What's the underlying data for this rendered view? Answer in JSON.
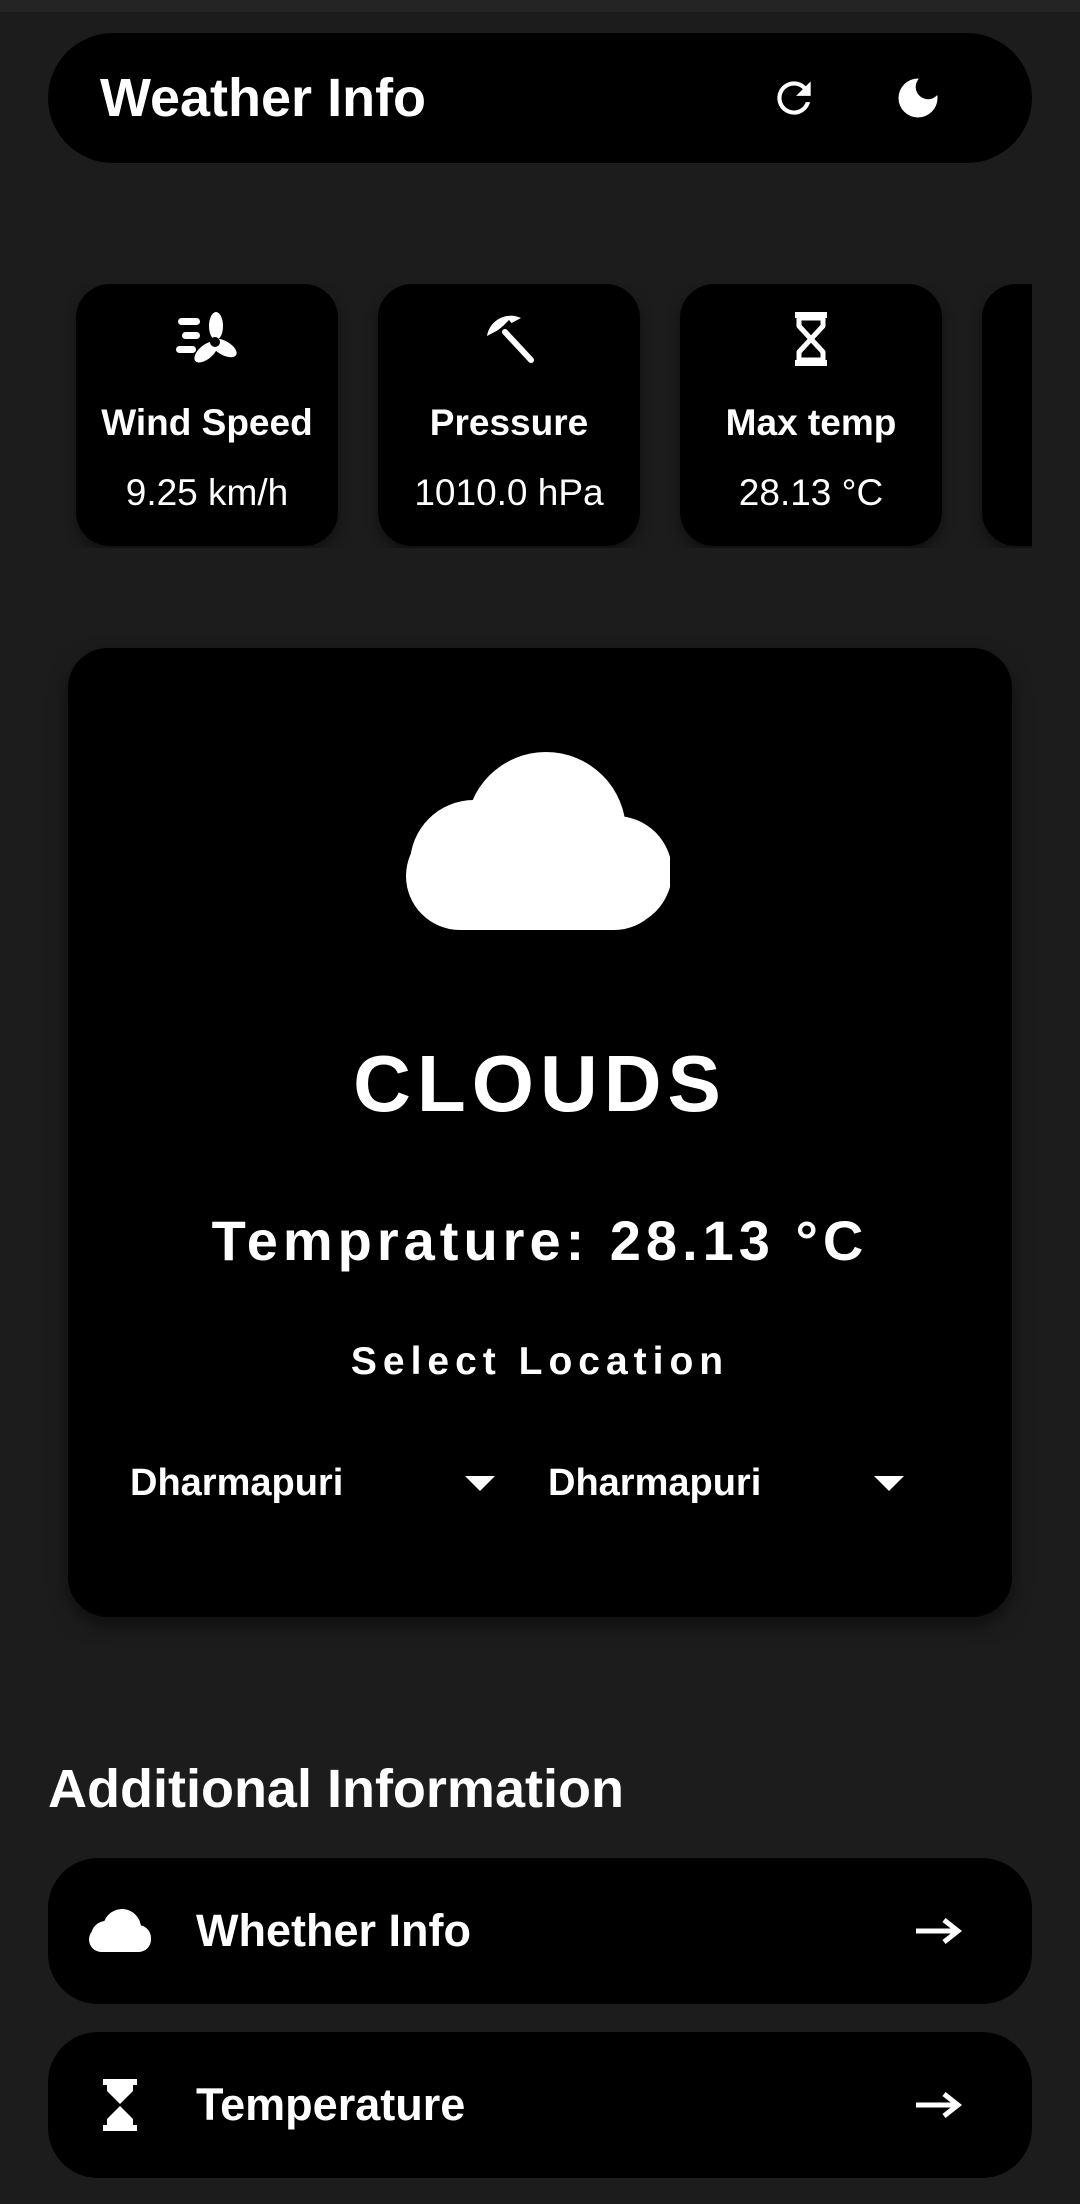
{
  "app": {
    "title": "Weather Info",
    "refresh_icon": "refresh-icon",
    "theme_icon": "dark-mode-moon-icon"
  },
  "metrics": [
    {
      "label": "Wind Speed",
      "value": "9.25 km/h",
      "icon": "wind-fan-icon"
    },
    {
      "label": "Pressure",
      "value": "1010.0 hPa",
      "icon": "umbrella-beach-icon"
    },
    {
      "label": "Max temp",
      "value": "28.13 °C",
      "icon": "hourglass-icon"
    }
  ],
  "weather": {
    "icon": "cloud-icon",
    "condition": "CLOUDS",
    "temperature": "Temprature: 28.13 °C",
    "select_label": "Select Location",
    "dropdowns": [
      {
        "value": "Dharmapuri"
      },
      {
        "value": "Dharmapuri"
      }
    ]
  },
  "additional": {
    "heading": "Additional Information",
    "items": [
      {
        "label": "Whether Info",
        "icon": "cloud-icon"
      },
      {
        "label": "Temperature",
        "icon": "hourglass-icon"
      }
    ]
  },
  "colors": {
    "background": "#1c1c1c",
    "surface": "#000000",
    "text": "#ffffff"
  }
}
